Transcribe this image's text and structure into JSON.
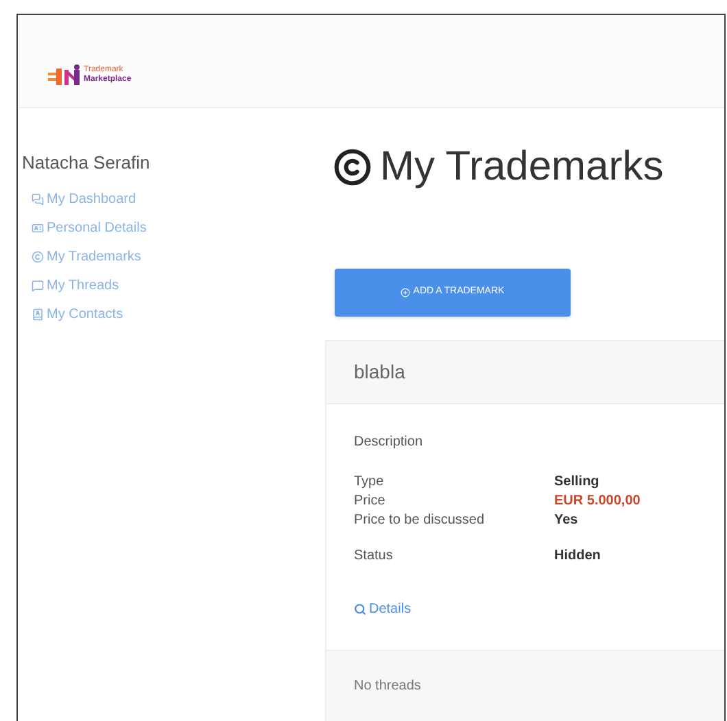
{
  "logo": {
    "line_1": "Trademark",
    "line_2": "Marketplace"
  },
  "sidebar": {
    "user_name": "Natacha Serafin",
    "items": [
      {
        "kind": "dashboard",
        "label": "My Dashboard"
      },
      {
        "kind": "details",
        "label": "Personal Details"
      },
      {
        "kind": "trademarks",
        "label": "My Trademarks"
      },
      {
        "kind": "threads",
        "label": "My Threads"
      },
      {
        "kind": "contacts",
        "label": "My Contacts"
      }
    ]
  },
  "page": {
    "title": "My Trademarks",
    "add_button": "ADD A TRADEMARK"
  },
  "trademark_card": {
    "name": "blabla",
    "section_label": "Description",
    "fields": [
      {
        "label": "Type",
        "value": "Selling",
        "kind": "plain"
      },
      {
        "label": "Price",
        "value": "EUR 5.000,00",
        "kind": "price"
      },
      {
        "label": "Price to be discussed",
        "value": "Yes",
        "kind": "plain"
      }
    ],
    "status": {
      "label": "Status",
      "value": "Hidden"
    },
    "details_link": "Details",
    "footer": "No threads"
  }
}
